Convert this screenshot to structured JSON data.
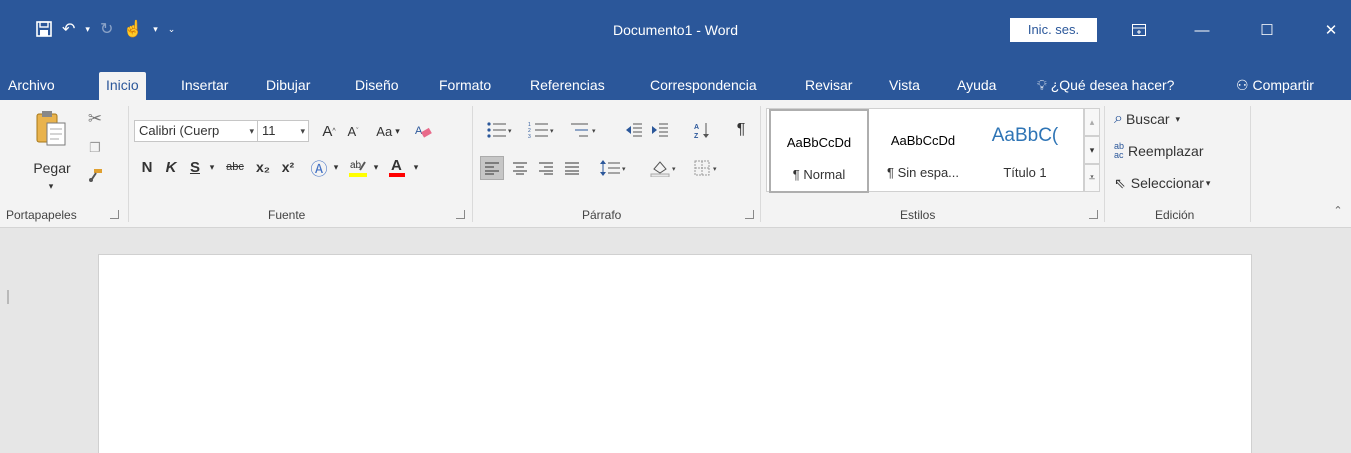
{
  "window": {
    "title": "Documento1 - Word",
    "signin_label": "Inic. ses."
  },
  "tabs": [
    "Archivo",
    "Inicio",
    "Insertar",
    "Dibujar",
    "Diseño",
    "Formato",
    "Referencias",
    "Correspondencia",
    "Revisar",
    "Vista",
    "Ayuda"
  ],
  "active_tab": "Inicio",
  "tell_me": "¿Qué desea hacer?",
  "share_label": "Compartir",
  "clipboard": {
    "paste_label": "Pegar",
    "group_label": "Portapapeles"
  },
  "font": {
    "font_name": "Calibri (Cuerp",
    "font_size": "11",
    "change_case": "Aa",
    "bold": "N",
    "italic": "K",
    "underline": "S",
    "strikethrough": "abc",
    "subscript": "x₂",
    "superscript": "x²",
    "group_label": "Fuente"
  },
  "paragraph": {
    "group_label": "Párrafo"
  },
  "styles": {
    "items": [
      {
        "sample": "AaBbCcDd",
        "name": "¶ Normal"
      },
      {
        "sample": "AaBbCcDd",
        "name": "¶ Sin espa..."
      },
      {
        "sample": "AaBbC(",
        "name": "Título 1"
      }
    ],
    "group_label": "Estilos"
  },
  "editing": {
    "find": "Buscar",
    "replace": "Reemplazar",
    "select": "Seleccionar",
    "group_label": "Edición"
  },
  "colors": {
    "brand": "#2b579a",
    "highlight": "#ffff00",
    "font_color": "#ff0000"
  }
}
